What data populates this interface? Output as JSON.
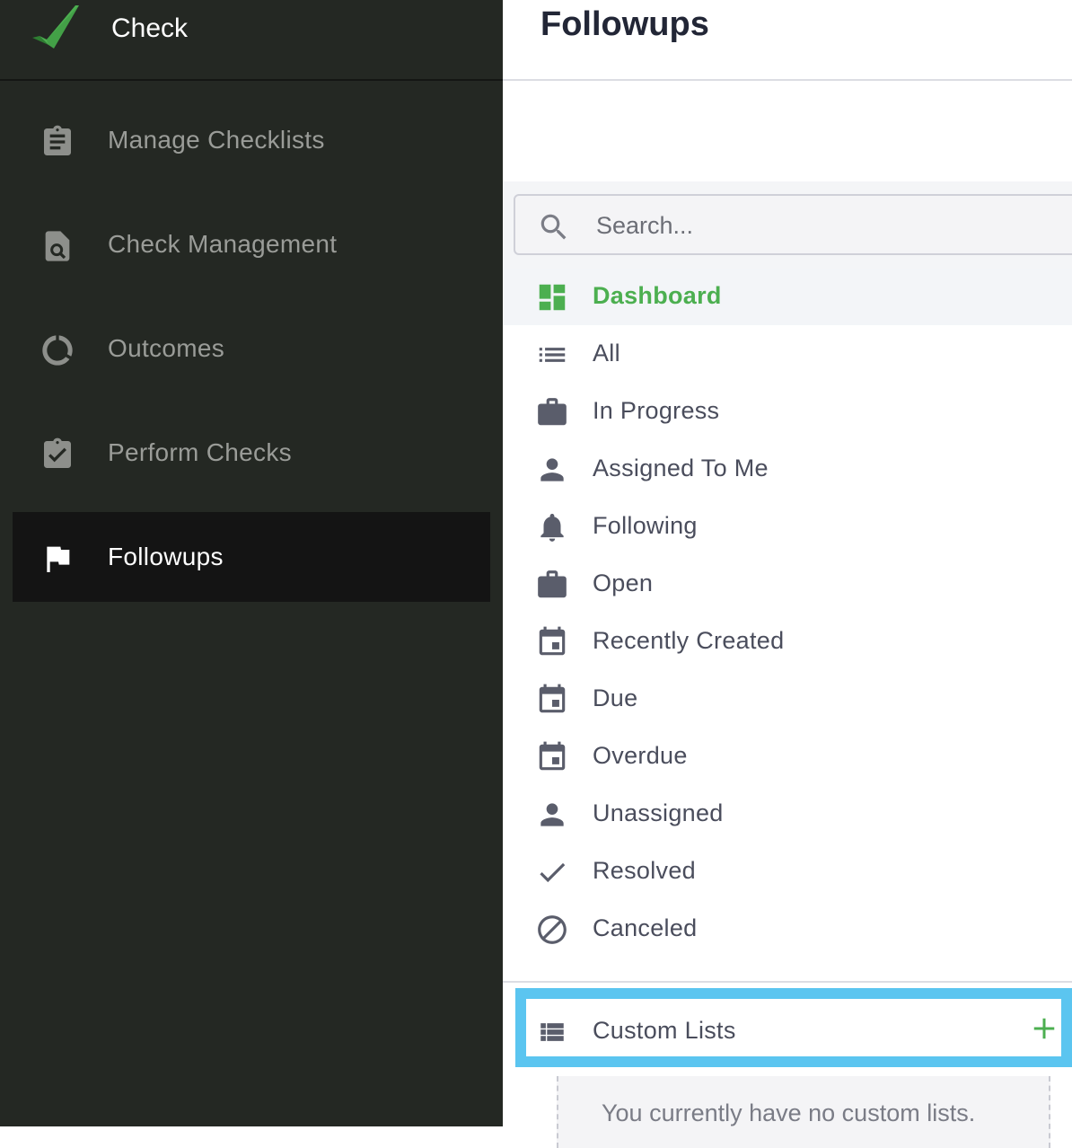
{
  "brand": {
    "name": "Check",
    "accent": "#4caf50"
  },
  "sidebar": {
    "items": [
      {
        "label": "Manage Checklists",
        "icon": "clipboard-icon"
      },
      {
        "label": "Check Management",
        "icon": "document-search-icon"
      },
      {
        "label": "Outcomes",
        "icon": "ring-icon"
      },
      {
        "label": "Perform Checks",
        "icon": "clipboard-check-icon"
      },
      {
        "label": "Followups",
        "icon": "flag-icon",
        "active": true
      }
    ]
  },
  "main": {
    "title": "Followups",
    "search": {
      "placeholder": "Search...",
      "value": ""
    },
    "list": [
      {
        "label": "Dashboard",
        "icon": "dashboard-icon",
        "active": true
      },
      {
        "label": "All",
        "icon": "list-icon"
      },
      {
        "label": "In Progress",
        "icon": "briefcase-icon"
      },
      {
        "label": "Assigned To Me",
        "icon": "person-icon"
      },
      {
        "label": "Following",
        "icon": "bell-icon"
      },
      {
        "label": "Open",
        "icon": "briefcase-icon"
      },
      {
        "label": "Recently Created",
        "icon": "calendar-icon"
      },
      {
        "label": "Due",
        "icon": "calendar-icon"
      },
      {
        "label": "Overdue",
        "icon": "calendar-icon"
      },
      {
        "label": "Unassigned",
        "icon": "person-icon"
      },
      {
        "label": "Resolved",
        "icon": "check-icon"
      },
      {
        "label": "Canceled",
        "icon": "block-icon"
      }
    ],
    "custom_lists": {
      "label": "Custom Lists",
      "icon": "view-list-icon",
      "add_icon": "plus-icon",
      "empty_text": "You currently have no custom lists.",
      "highlight_color": "#5bc5f0"
    }
  }
}
